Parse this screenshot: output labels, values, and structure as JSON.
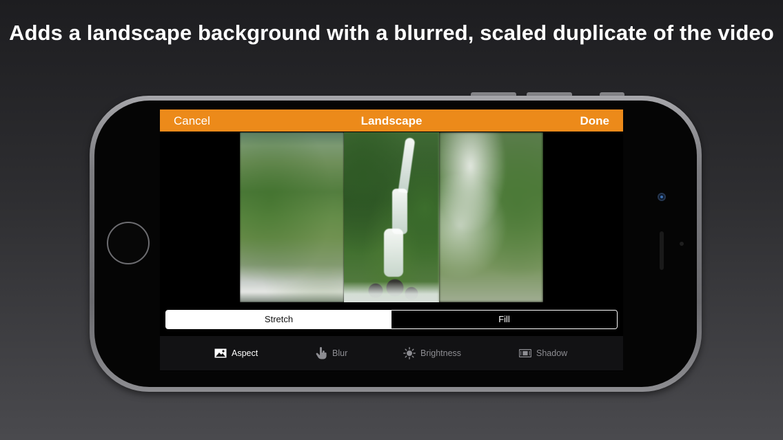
{
  "headline": "Adds a landscape background with a blurred, scaled duplicate of the video",
  "navbar": {
    "cancel_label": "Cancel",
    "title": "Landscape",
    "done_label": "Done",
    "color": "#ec8a1a"
  },
  "segmented": {
    "options": [
      {
        "label": "Stretch",
        "selected": true
      },
      {
        "label": "Fill",
        "selected": false
      }
    ]
  },
  "toolbar": {
    "items": [
      {
        "label": "Aspect",
        "icon": "image-icon",
        "active": true
      },
      {
        "label": "Blur",
        "icon": "hand-pointer-icon",
        "active": false
      },
      {
        "label": "Brightness",
        "icon": "sun-icon",
        "active": false
      },
      {
        "label": "Shadow",
        "icon": "shadow-icon",
        "active": false
      }
    ]
  }
}
